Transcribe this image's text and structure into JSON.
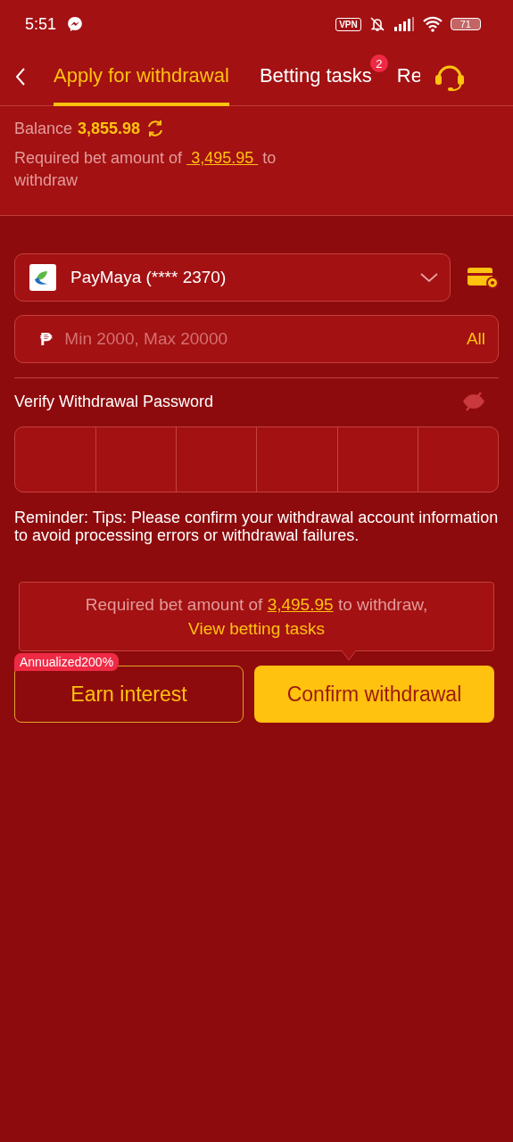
{
  "status_bar": {
    "time": "5:51",
    "vpn": "VPN",
    "battery": "71"
  },
  "tabs": [
    {
      "label": "Apply for withdrawal",
      "selected": true
    },
    {
      "label": "Betting tasks",
      "selected": false,
      "badge": "2"
    },
    {
      "label": "Re",
      "selected": false
    }
  ],
  "balance": {
    "label": "Balance",
    "amount": "3,855.98"
  },
  "requirement": {
    "before": "Required bet amount of",
    "amount": "3,495.95",
    "after": "to withdraw"
  },
  "account": {
    "name": "PayMaya (**** 2370)"
  },
  "amount_field": {
    "currency": "₱",
    "placeholder": "Min 2000, Max 20000",
    "all": "All"
  },
  "password": {
    "label": "Verify Withdrawal Password"
  },
  "reminder": "Reminder: Tips: Please confirm your withdrawal account information to avoid processing errors or withdrawal failures.",
  "tooltip": {
    "before": "Required bet amount of",
    "amount": "3,495.95",
    "after": "to withdraw,",
    "link": "View betting tasks"
  },
  "buttons": {
    "earn": {
      "label": "Earn interest",
      "badge": "Annualized200%"
    },
    "confirm": {
      "label": "Confirm withdrawal"
    }
  }
}
